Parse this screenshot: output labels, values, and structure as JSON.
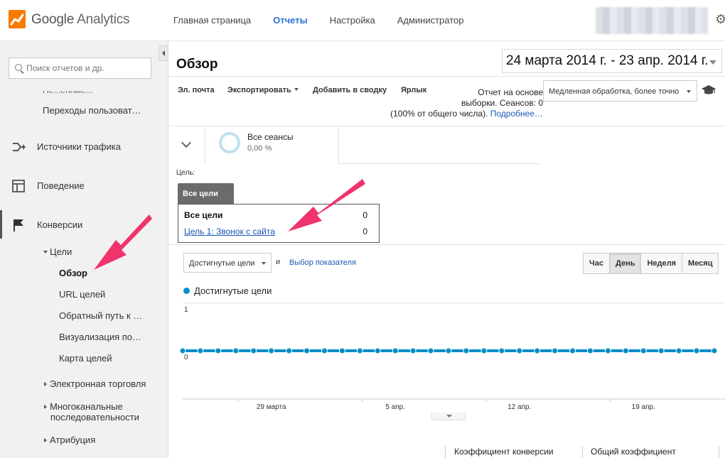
{
  "brand": {
    "name_main": "Google",
    "name_product": "Analytics"
  },
  "top_nav": [
    {
      "label": "Главная страница",
      "active": false
    },
    {
      "label": "Отчеты",
      "active": true
    },
    {
      "label": "Настройка",
      "active": false
    },
    {
      "label": "Администратор",
      "active": false
    }
  ],
  "sidebar": {
    "search_placeholder": "Поиск отчетов и др.",
    "cut_item": "Пе...енные...",
    "user_flow": "Переходы пользоват…",
    "sections": {
      "acquisition": "Источники трафика",
      "behavior": "Поведение",
      "conversions": "Конверсии"
    },
    "goals": {
      "label": "Цели",
      "items": [
        "Обзор",
        "URL целей",
        "Обратный путь к …",
        "Визуализация по…",
        "Карта целей"
      ],
      "active_item": "Обзор"
    },
    "ecommerce": "Электронная торговля",
    "multichannel_line1": "Многоканальные",
    "multichannel_line2": "последовательности",
    "attribution": "Атрибуция"
  },
  "header": {
    "title": "Обзор",
    "date_range": "24 марта 2014 г. - 23 апр. 2014 г."
  },
  "toolbar": {
    "email": "Эл. почта",
    "export": "Экспортировать",
    "add_to_dashboard": "Добавить в сводку",
    "shortcut": "Ярлык"
  },
  "sampling": {
    "line1": "Отчет на основе",
    "line2": "выборки. Сеансов: 0",
    "line3": "(100% от общего числа).",
    "more_link": "Подробнее…",
    "select_value": "Медленная обработка, более точно"
  },
  "segment": {
    "name": "Все сеансы",
    "value": "0,00 %"
  },
  "goal_selector": {
    "label": "Цель:",
    "tab": "Все цели",
    "rows": [
      {
        "name": "Все цели",
        "value": "0"
      },
      {
        "name": "Цель 1: Звонок с сайта",
        "value": "0"
      }
    ]
  },
  "metric_controls": {
    "metric": "Достигнутые цели",
    "and": "и",
    "choose_metric": "Выбор показателя",
    "periods": [
      {
        "label": "Час",
        "active": false
      },
      {
        "label": "День",
        "active": true
      },
      {
        "label": "Неделя",
        "active": false
      },
      {
        "label": "Месяц",
        "active": false
      }
    ]
  },
  "chart_data": {
    "type": "line",
    "series": [
      {
        "name": "Достигнутые цели",
        "color": "#058dc7",
        "values": [
          0,
          0,
          0,
          0,
          0,
          0,
          0,
          0,
          0,
          0,
          0,
          0,
          0,
          0,
          0,
          0,
          0,
          0,
          0,
          0,
          0,
          0,
          0,
          0,
          0,
          0,
          0,
          0,
          0,
          0,
          0
        ]
      }
    ],
    "y_ticks": [
      "1",
      "0"
    ],
    "ylim": [
      0,
      1
    ],
    "x_tick_labels": [
      "29 марта",
      "5 апр.",
      "12 апр.",
      "19 апр."
    ],
    "x_tick_indices": [
      5,
      12,
      19,
      26
    ],
    "grid": true
  },
  "bottom_columns": {
    "conversion_rate": "Коэффициент конверсии",
    "total_rate": "Общий коэффициент"
  },
  "colors": {
    "accent_blue": "#058dc7",
    "link_blue": "#1a58b5",
    "annotation_pink": "#f0336b"
  }
}
